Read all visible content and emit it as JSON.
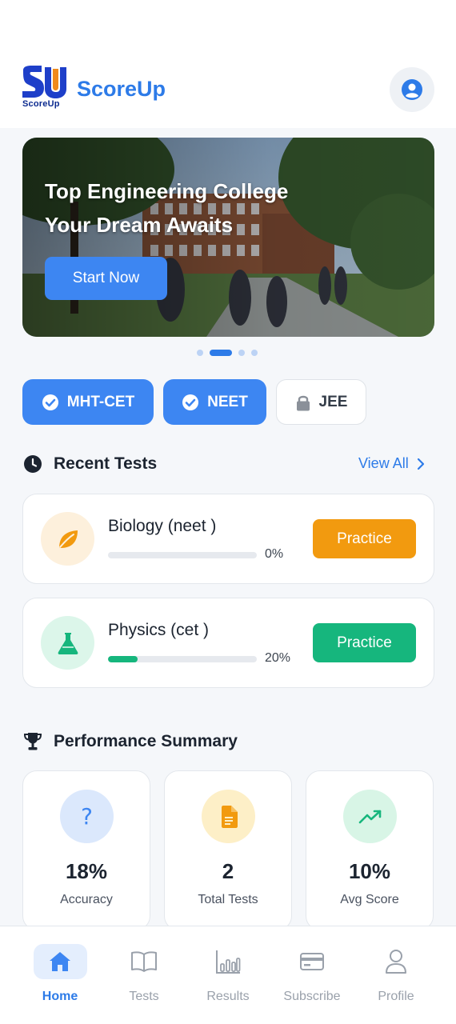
{
  "app": {
    "title": "ScoreUp",
    "logo_text": "ScoreUp",
    "logo_mark": "SU"
  },
  "header": {
    "profile_icon": "user-circle-icon"
  },
  "banner": {
    "line1": "Top Engineering College",
    "line2": "Your Dream Awaits",
    "button_label": "Start Now",
    "carousel_total": 4,
    "carousel_active": 2
  },
  "exam_chips": [
    {
      "label": "MHT-CET",
      "state": "selected",
      "icon": "check-circle-icon"
    },
    {
      "label": "NEET",
      "state": "selected",
      "icon": "check-circle-icon"
    },
    {
      "label": "JEE",
      "state": "locked",
      "icon": "lock-icon"
    }
  ],
  "recent_tests": {
    "title": "Recent Tests",
    "view_all": "View All",
    "items": [
      {
        "name": "Biology (neet )",
        "progress": 0,
        "progress_label": "0%",
        "button": "Practice",
        "icon": "leaf-icon",
        "accent": "#f29a0f",
        "icon_bg": "#fdf0dc"
      },
      {
        "name": "Physics (cet )",
        "progress": 0.2,
        "progress_label": "20%",
        "button": "Practice",
        "icon": "flask-icon",
        "accent": "#16b67d",
        "icon_bg": "#dcf6ea"
      }
    ]
  },
  "performance": {
    "title": "Performance Summary",
    "stats": [
      {
        "value": "18%",
        "label": "Accuracy",
        "icon": "question-icon",
        "icon_bg": "#dbe8fc",
        "icon_color": "#3d86f2"
      },
      {
        "value": "2",
        "label": "Total Tests",
        "icon": "document-icon",
        "icon_bg": "#fdefc7",
        "icon_color": "#f29a0f"
      },
      {
        "value": "10%",
        "label": "Avg Score",
        "icon": "trending-up-icon",
        "icon_bg": "#d8f5e6",
        "icon_color": "#16b67d"
      }
    ]
  },
  "nav": {
    "items": [
      {
        "label": "Home",
        "icon": "home-icon",
        "active": true
      },
      {
        "label": "Tests",
        "icon": "book-icon",
        "active": false
      },
      {
        "label": "Results",
        "icon": "bar-chart-icon",
        "active": false
      },
      {
        "label": "Subscribe",
        "icon": "credit-card-icon",
        "active": false
      },
      {
        "label": "Profile",
        "icon": "user-icon",
        "active": false
      }
    ]
  },
  "colors": {
    "primary": "#3d86f2",
    "brand_text": "#2d7be8",
    "warning": "#f29a0f",
    "success": "#16b67d"
  }
}
